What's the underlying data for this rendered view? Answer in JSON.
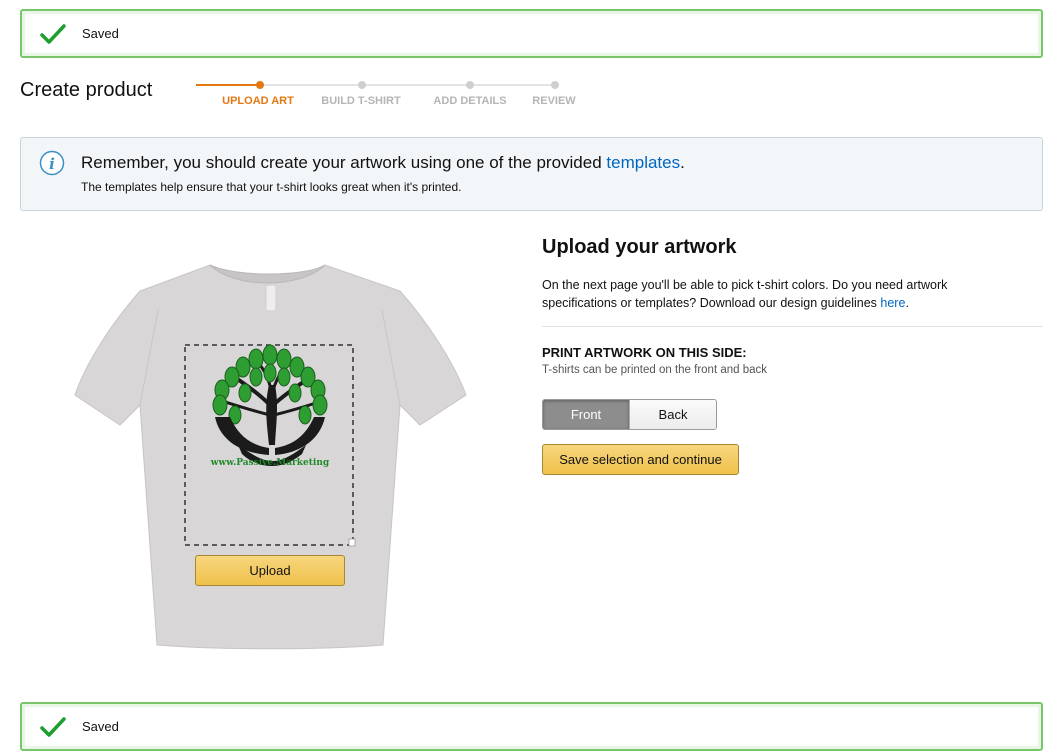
{
  "banner_top": {
    "text": "Saved"
  },
  "banner_bottom": {
    "text": "Saved"
  },
  "page_title": "Create product",
  "stepper": {
    "steps": [
      {
        "label": "UPLOAD ART",
        "state": "active"
      },
      {
        "label": "BUILD T-SHIRT",
        "state": "pending"
      },
      {
        "label": "ADD DETAILS",
        "state": "pending"
      },
      {
        "label": "REVIEW",
        "state": "pending"
      }
    ],
    "active_color": "#e47911",
    "inactive_color": "#bbbbbb"
  },
  "info": {
    "icon": "info-icon",
    "main_prefix": "Remember, you should create your artwork using one of the provided ",
    "main_link": "templates",
    "main_suffix": ".",
    "sub": "The templates help ensure that your t-shirt looks great when it's printed."
  },
  "preview": {
    "artwork_caption": "www.Passive.Marketing",
    "upload_label": "Upload"
  },
  "panel": {
    "heading": "Upload your artwork",
    "desc_prefix": "On the next page you'll be able to pick t-shirt colors. Do you need artwork specifications or templates? Download our design guidelines ",
    "desc_link": "here",
    "desc_suffix": ".",
    "side_title": "PRINT ARTWORK ON THIS SIDE:",
    "side_sub": "T-shirts can be printed on the front and back",
    "toggle": {
      "front": "Front",
      "back": "Back",
      "selected": "Front"
    },
    "save_label": "Save selection and continue"
  },
  "colors": {
    "success_green": "#1e9e2e",
    "link_blue": "#0066c0",
    "button_yellow": "#f0c14b",
    "shirt": "#d9d6d7"
  }
}
